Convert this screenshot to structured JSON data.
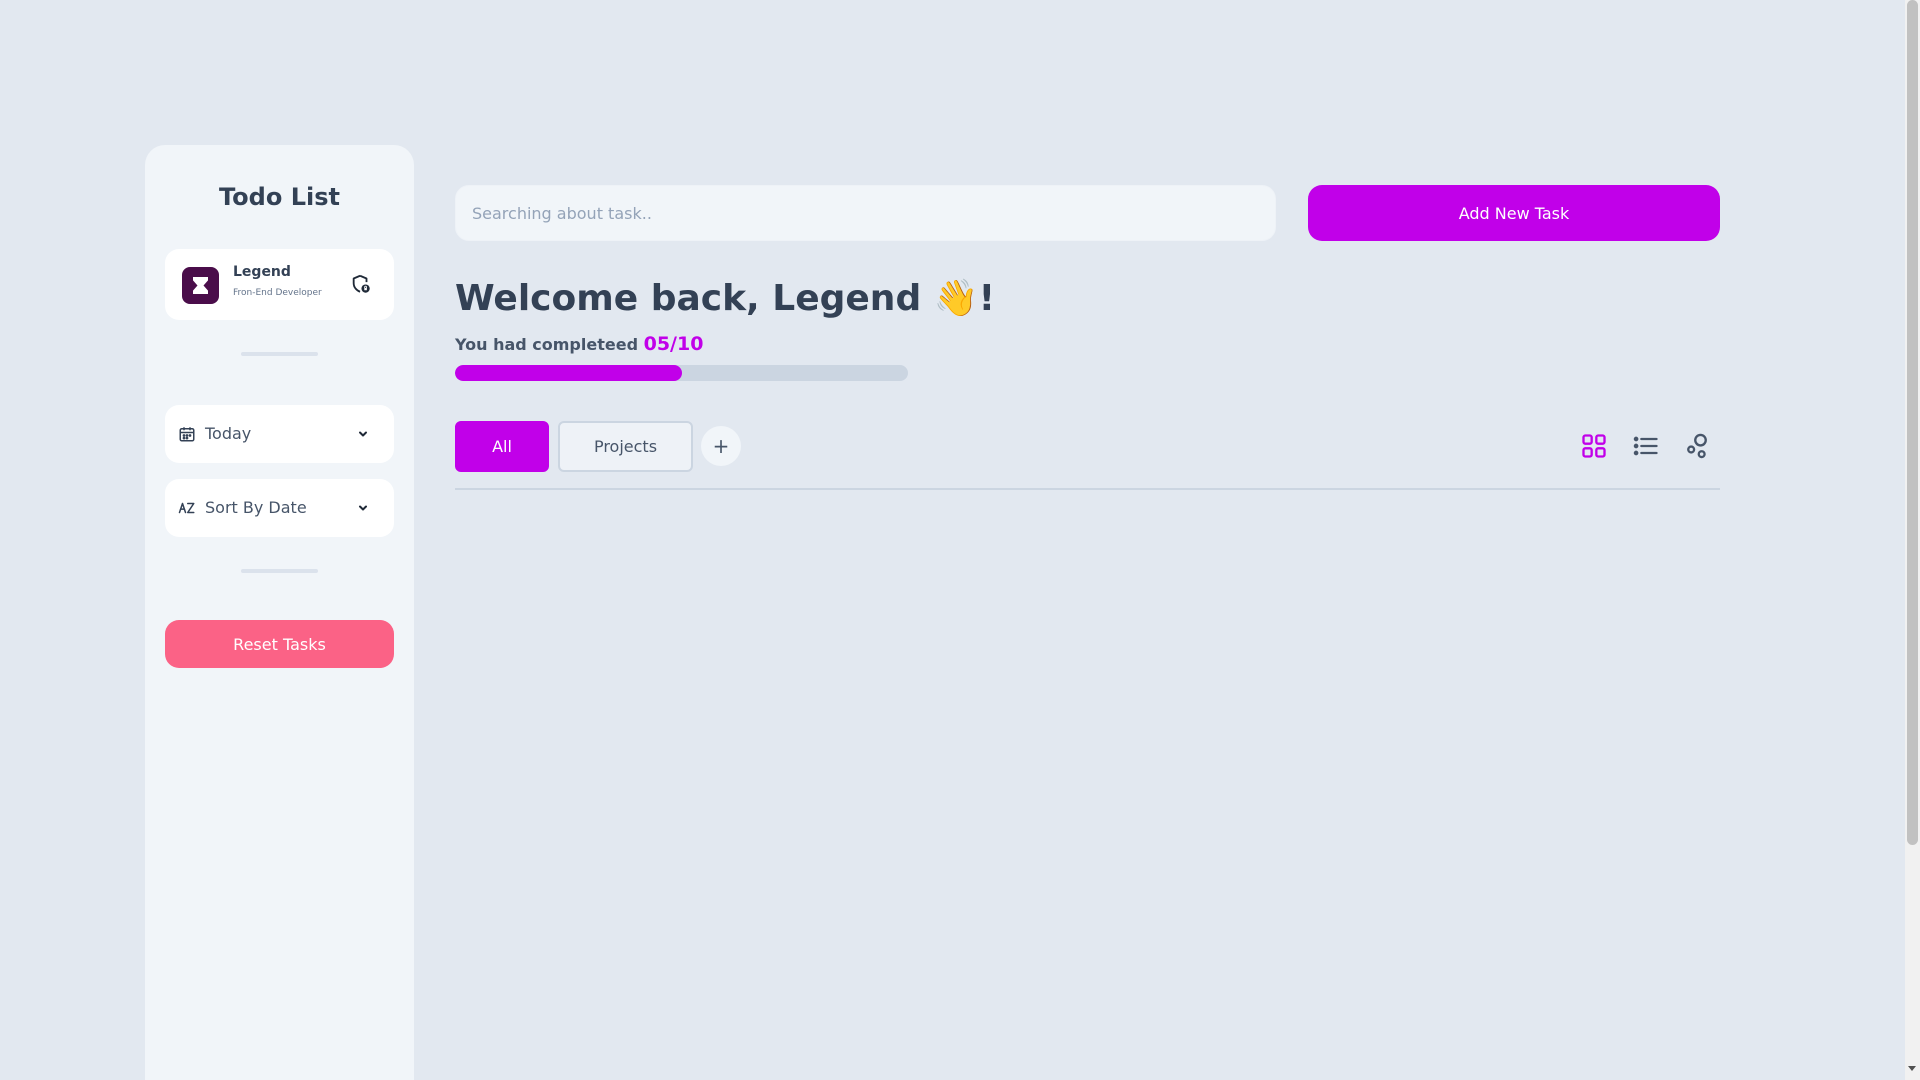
{
  "sidebar": {
    "title": "Todo List",
    "profile": {
      "name": "Legend",
      "role": "Fron-End Developer"
    },
    "filters": [
      {
        "label": "Today",
        "icon": "calendar-icon"
      },
      {
        "label": "Sort By Date",
        "icon": "sort-az-icon"
      }
    ],
    "reset_label": "Reset Tasks"
  },
  "header": {
    "search_placeholder": "Searching about task..",
    "add_label": "Add New Task"
  },
  "welcome": {
    "greeting": "Welcome back, Legend 👋!",
    "completed_prefix": "You had completeed",
    "completed_count": "05/10",
    "progress_fraction": 0.5
  },
  "tabs": [
    {
      "label": "All",
      "active": true
    },
    {
      "label": "Projects",
      "active": false
    }
  ],
  "add_tab_label": "+",
  "view_modes": [
    {
      "icon": "grid-view-icon",
      "active": true
    },
    {
      "icon": "list-view-icon",
      "active": false
    },
    {
      "icon": "shapes-view-icon",
      "active": false
    }
  ],
  "colors": {
    "accent": "#c100e9",
    "danger": "#fb6286",
    "background": "#e2e8f0",
    "panel": "#f1f5f9"
  }
}
